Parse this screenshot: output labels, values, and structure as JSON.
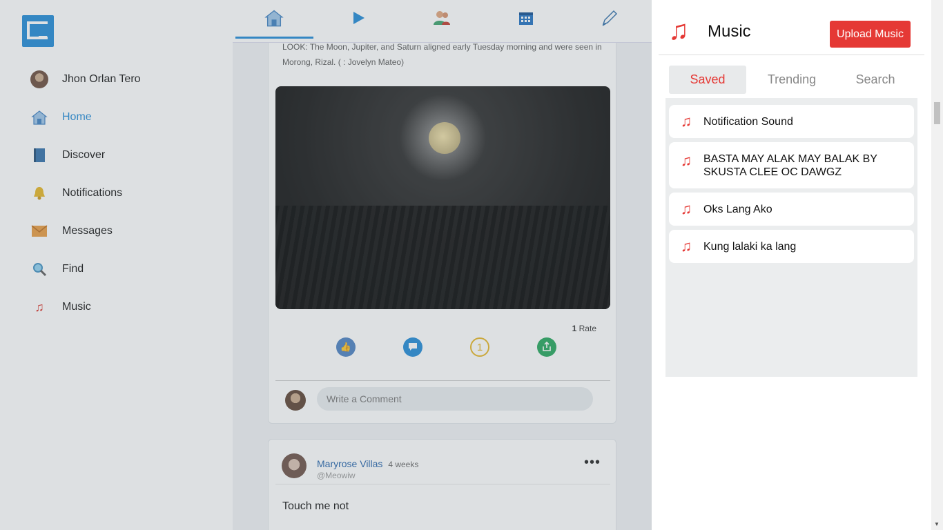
{
  "sidebar": {
    "user_name": "Jhon Orlan Tero",
    "items": [
      {
        "label": "Home"
      },
      {
        "label": "Discover"
      },
      {
        "label": "Notifications"
      },
      {
        "label": "Messages"
      },
      {
        "label": "Find"
      },
      {
        "label": "Music"
      }
    ]
  },
  "post1": {
    "caption": "LOOK: The Moon, Jupiter, and Saturn aligned early Tuesday morning and were seen in Morong, Rizal. (     : Jovelyn Mateo)",
    "rate_count": "1",
    "rate_label": "Rate",
    "comment_placeholder": "Write a Comment"
  },
  "post2": {
    "author": "Maryrose Villas",
    "time": "4 weeks",
    "handle": "@Meowiw",
    "more": "•••",
    "text": "Touch me not"
  },
  "music_panel": {
    "title": "Music",
    "upload_label": "Upload Music",
    "tabs": [
      "Saved",
      "Trending",
      "Search"
    ],
    "songs": [
      "Notification Sound",
      "BASTA MAY ALAK MAY BALAK BY SKUSTA CLEE OC DAWGZ",
      "Oks Lang Ako",
      "Kung lalaki ka lang"
    ]
  },
  "colors": {
    "accent_blue": "#1e88d6",
    "accent_red": "#e53935"
  }
}
